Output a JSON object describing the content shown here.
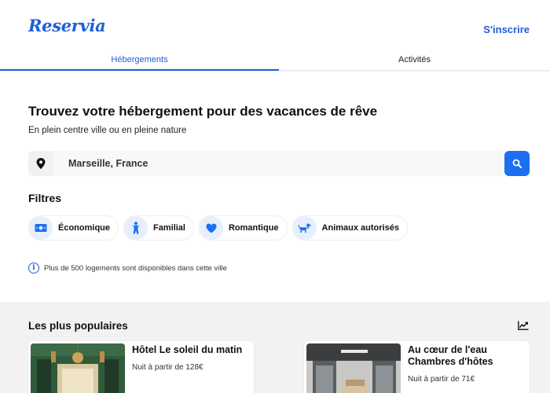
{
  "app": {
    "brand": "Reservia",
    "signup_label": "S'inscrire"
  },
  "tabs": [
    {
      "label": "Hébergements",
      "active": true
    },
    {
      "label": "Activités",
      "active": false
    }
  ],
  "hero": {
    "title": "Trouvez votre hébergement pour des vacances de rêve",
    "subtitle": "En plein centre ville ou en pleine nature"
  },
  "search": {
    "value": "Marseille, France",
    "pin_icon": "map-pin-icon",
    "button_icon": "search-icon"
  },
  "filters": {
    "title": "Filtres",
    "items": [
      {
        "label": "Économique",
        "icon": "money-icon"
      },
      {
        "label": "Familial",
        "icon": "child-icon"
      },
      {
        "label": "Romantique",
        "icon": "heart-icon"
      },
      {
        "label": "Animaux autorisés",
        "icon": "dog-icon"
      }
    ]
  },
  "info": {
    "text": "Plus de 500 logements sont disponibles dans cette ville"
  },
  "popular": {
    "title": "Les plus populaires",
    "icon": "trend-up-icon",
    "cards": [
      {
        "title": "Hôtel Le soleil du matin",
        "price": "Nuit à partir de 128€"
      },
      {
        "title": "Au cœur de l'eau Chambres d'hôtes",
        "price": "Nuit à partir de 71€"
      }
    ]
  },
  "colors": {
    "accent": "#1d5fd6",
    "button": "#1d6ff2",
    "chip_icon_bg": "#e6effb",
    "section_bg": "#f2f2f2"
  }
}
